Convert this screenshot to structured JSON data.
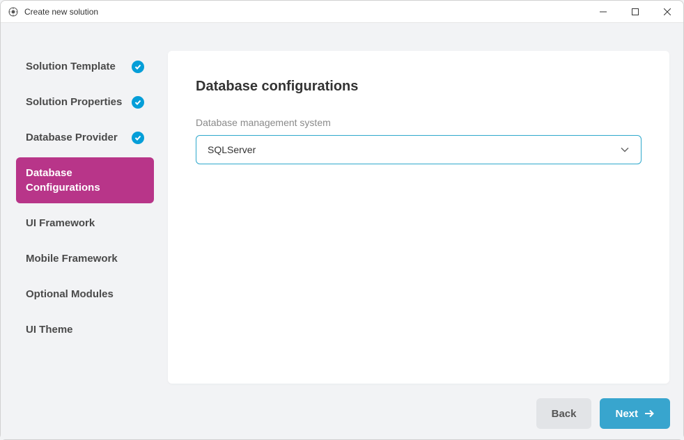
{
  "window": {
    "title": "Create new solution"
  },
  "sidebar": {
    "items": [
      {
        "label": "Solution Template",
        "completed": true,
        "active": false
      },
      {
        "label": "Solution Properties",
        "completed": true,
        "active": false
      },
      {
        "label": "Database Provider",
        "completed": true,
        "active": false
      },
      {
        "label": "Database Configurations",
        "completed": false,
        "active": true
      },
      {
        "label": "UI Framework",
        "completed": false,
        "active": false
      },
      {
        "label": "Mobile Framework",
        "completed": false,
        "active": false
      },
      {
        "label": "Optional Modules",
        "completed": false,
        "active": false
      },
      {
        "label": "UI Theme",
        "completed": false,
        "active": false
      }
    ]
  },
  "main": {
    "title": "Database configurations",
    "field_label": "Database management system",
    "select_value": "SQLServer"
  },
  "footer": {
    "back_label": "Back",
    "next_label": "Next"
  }
}
